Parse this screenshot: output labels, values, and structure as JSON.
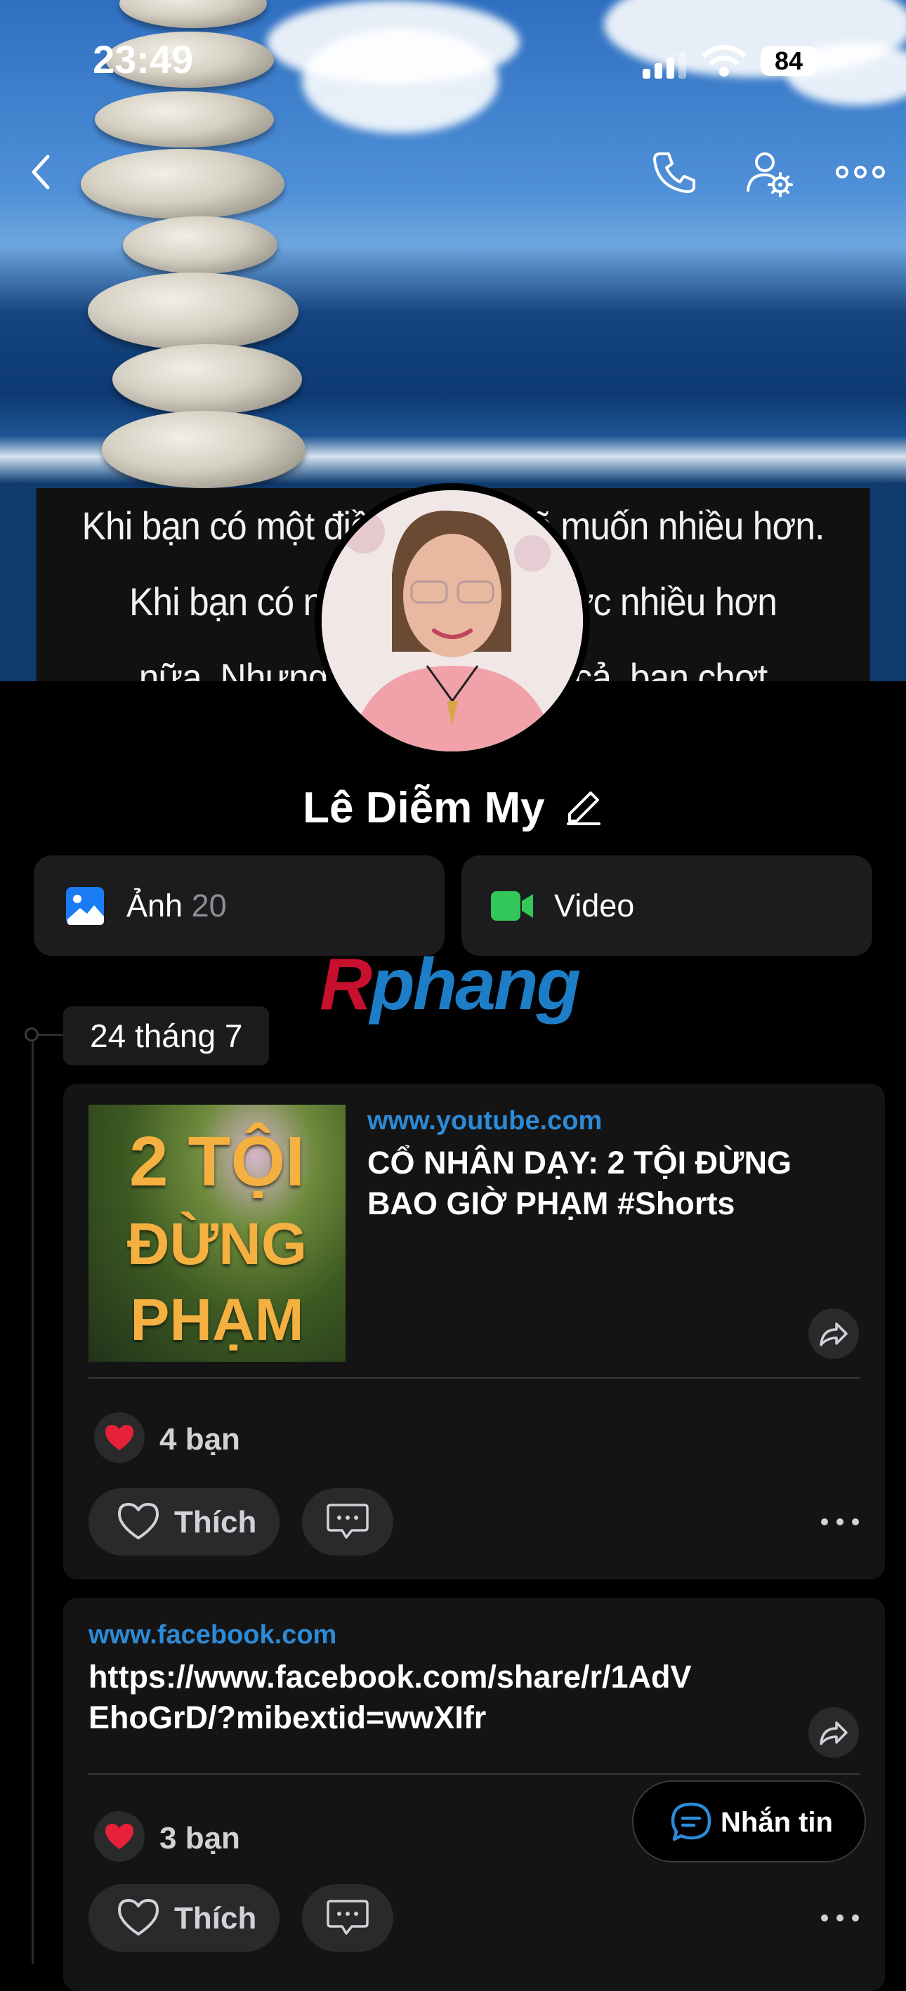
{
  "status_bar": {
    "time": "23:49",
    "battery": "84"
  },
  "cover": {
    "quote_lines": [
      "Khi bạn có một điều gì, bạn sẽ muốn nhiều hơn.",
      "Khi bạn có nhiều hơn, bạn ước nhiều hơn",
      "nữa. Nhưng khi bạn mất tất cả, bạn chợt"
    ]
  },
  "header": {
    "back_icon": "chevron-left-icon",
    "call_icon": "phone-icon",
    "settings_icon": "user-gear-icon",
    "more_icon": "more-horizontal-icon"
  },
  "profile": {
    "name": "Lê Diễm My"
  },
  "media_tiles": [
    {
      "label": "Ảnh",
      "count": "20",
      "icon": "photo-icon",
      "color": "#1a7cf5"
    },
    {
      "label": "Video",
      "count": "",
      "icon": "video-icon",
      "color": "#34c759"
    }
  ],
  "watermark": {
    "r": "R",
    "rest": "phang"
  },
  "timeline": {
    "date": "24 tháng 7"
  },
  "posts": [
    {
      "domain": "www.youtube.com",
      "title": "CỔ NHÂN DẠY: 2 TỘI ĐỪNG BAO GIỜ PHẠM #Shorts",
      "thumb_text": [
        "2 TỘI",
        "ĐỪNG",
        "PHẠM"
      ],
      "reactions": "4 bạn",
      "like_label": "Thích"
    },
    {
      "domain": "www.facebook.com",
      "title": "https://www.facebook.com/share/r/1AdVEhoGrD/?mibextid=wwXIfr",
      "reactions": "3 bạn",
      "like_label": "Thích"
    }
  ],
  "message_button": {
    "label": "Nhắn tin"
  },
  "colors": {
    "link": "#2d8ad6",
    "heart": "#e8203a",
    "message_icon": "#2d8ad6"
  }
}
